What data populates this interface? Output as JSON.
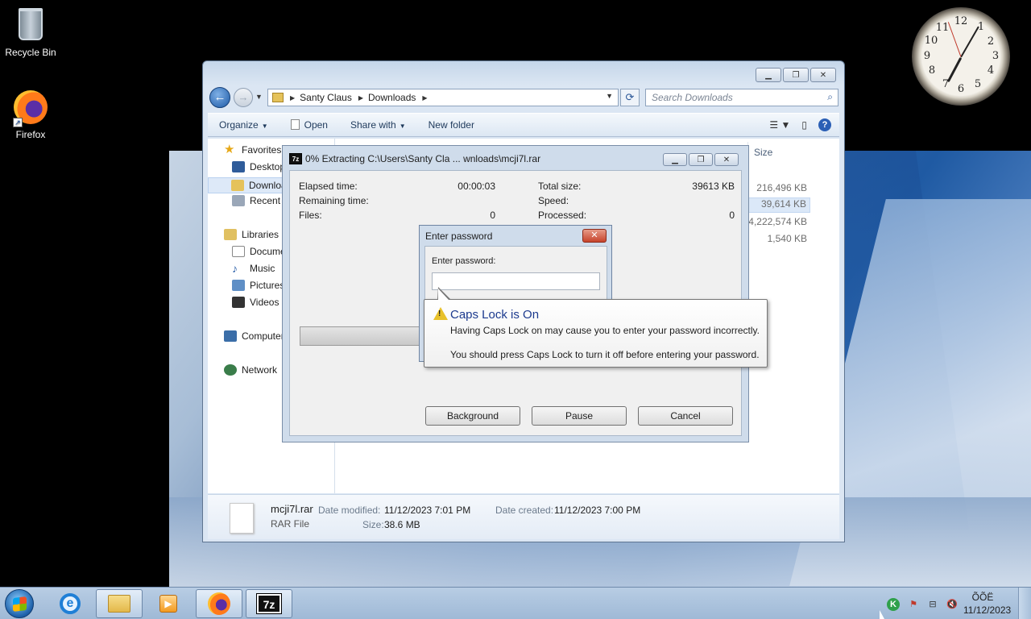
{
  "desktop": {
    "icons": [
      {
        "label": "Recycle Bin",
        "icon": "recycle-bin-icon"
      },
      {
        "label": "Firefox",
        "icon": "firefox-icon"
      }
    ]
  },
  "clock": {
    "numbers": [
      "12",
      "1",
      "2",
      "3",
      "4",
      "5",
      "6",
      "7",
      "8",
      "9",
      "10",
      "11"
    ]
  },
  "explorer": {
    "breadcrumb": [
      "Santy Claus",
      "Downloads"
    ],
    "search_placeholder": "Search Downloads",
    "commands": [
      "Organize",
      "Open",
      "Share with",
      "New folder"
    ],
    "nav": {
      "favorites": "Favorites",
      "desktop": "Desktop",
      "downloads": "Downloads",
      "recent": "Recent Places",
      "libraries": "Libraries",
      "documents": "Documents",
      "music": "Music",
      "pictures": "Pictures",
      "videos": "Videos",
      "computer": "Computer",
      "network": "Network"
    },
    "columns": {
      "size": "Size"
    },
    "sizes": [
      "216,496 KB",
      "39,614 KB",
      "4,222,574 KB",
      "1,540 KB"
    ],
    "details": {
      "name": "mcji7l.rar",
      "type": "RAR File",
      "date_modified_label": "Date modified:",
      "date_modified": "11/12/2023 7:01 PM",
      "date_created_label": "Date created:",
      "date_created": "11/12/2023 7:00 PM",
      "size_label": "Size:",
      "size": "38.6 MB"
    }
  },
  "zip": {
    "title": "0% Extracting C:\\Users\\Santy Cla ... wnloads\\mcji7l.rar",
    "elapsed_label": "Elapsed time:",
    "elapsed": "00:00:03",
    "remaining_label": "Remaining time:",
    "files_label": "Files:",
    "files": "0",
    "total_label": "Total size:",
    "total": "39613 KB",
    "speed_label": "Speed:",
    "processed_label": "Processed:",
    "processed": "0",
    "progress": 0,
    "buttons": {
      "background": "Background",
      "pause": "Pause",
      "cancel": "Cancel"
    }
  },
  "password_dialog": {
    "title": "Enter password",
    "label": "Enter password:",
    "value": ""
  },
  "balloon": {
    "title": "Caps Lock is On",
    "line1": "Having Caps Lock on may cause you to enter your password incorrectly.",
    "line2": "You should press Caps Lock to turn it off before entering your password."
  },
  "taskbar": {
    "time": "ÕÕË",
    "date": "11/12/2023"
  }
}
